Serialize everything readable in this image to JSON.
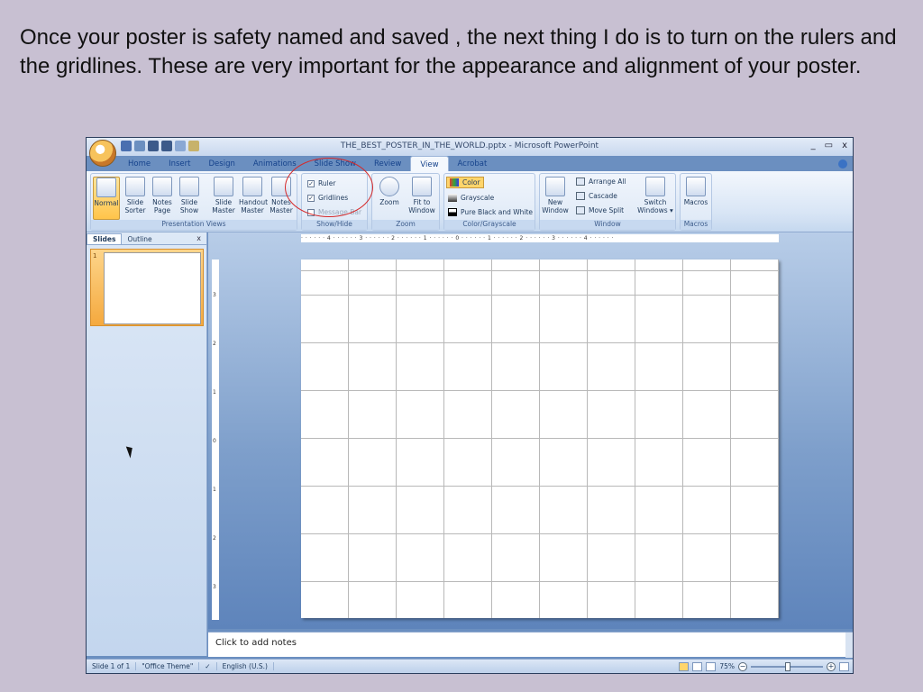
{
  "caption": "Once your poster is safety named and saved , the next thing I do is to turn on the rulers and the gridlines. These are very important for the appearance and alignment of your poster.",
  "window": {
    "title": "THE_BEST_POSTER_IN_THE_WORLD.pptx - Microsoft PowerPoint",
    "controls": {
      "minimize": "_",
      "restore": "▭",
      "close": "x"
    }
  },
  "tabs": [
    "Home",
    "Insert",
    "Design",
    "Animations",
    "Slide Show",
    "Review",
    "View",
    "Acrobat"
  ],
  "active_tab": "View",
  "ribbon": {
    "presentation_views": {
      "label": "Presentation Views",
      "buttons": [
        "Normal",
        "Slide Sorter",
        "Notes Page",
        "Slide Show",
        "Slide Master",
        "Handout Master",
        "Notes Master"
      ]
    },
    "show_hide": {
      "label": "Show/Hide",
      "ruler": "Ruler",
      "gridlines": "Gridlines",
      "message_bar": "Message Bar",
      "ruler_checked": true,
      "gridlines_checked": true,
      "message_bar_checked": false
    },
    "zoom": {
      "label": "Zoom",
      "zoom_btn": "Zoom",
      "fit_btn": "Fit to Window"
    },
    "color": {
      "label": "Color/Grayscale",
      "color": "Color",
      "grayscale": "Grayscale",
      "pure_bw": "Pure Black and White"
    },
    "window": {
      "label": "Window",
      "new_window": "New Window",
      "arrange_all": "Arrange All",
      "cascade": "Cascade",
      "move_split": "Move Split",
      "switch_windows": "Switch Windows"
    },
    "macros": {
      "label": "Macros",
      "macros_btn": "Macros"
    }
  },
  "slides_pane": {
    "tab_slides": "Slides",
    "tab_outline": "Outline",
    "close": "x",
    "slide_number": "1"
  },
  "rulers": {
    "horizontal": "· · · · · · 4 · · · · · · 3 · · · · · · 2 · · · · · · 1 · · · · · · 0 · · · · · · 1 · · · · · · 2 · · · · · · 3 · · · · · · 4 · · · · · ·",
    "vertical_marks": [
      "3",
      "2",
      "1",
      "0",
      "1",
      "2",
      "3"
    ]
  },
  "notes_placeholder": "Click to add notes",
  "status": {
    "slide": "Slide 1 of 1",
    "theme": "\"Office Theme\"",
    "language": "English (U.S.)",
    "zoom": "75%"
  },
  "colors": {
    "accent": "#ffc44a",
    "annotation": "#d62828",
    "frame": "#6b8fc0"
  }
}
